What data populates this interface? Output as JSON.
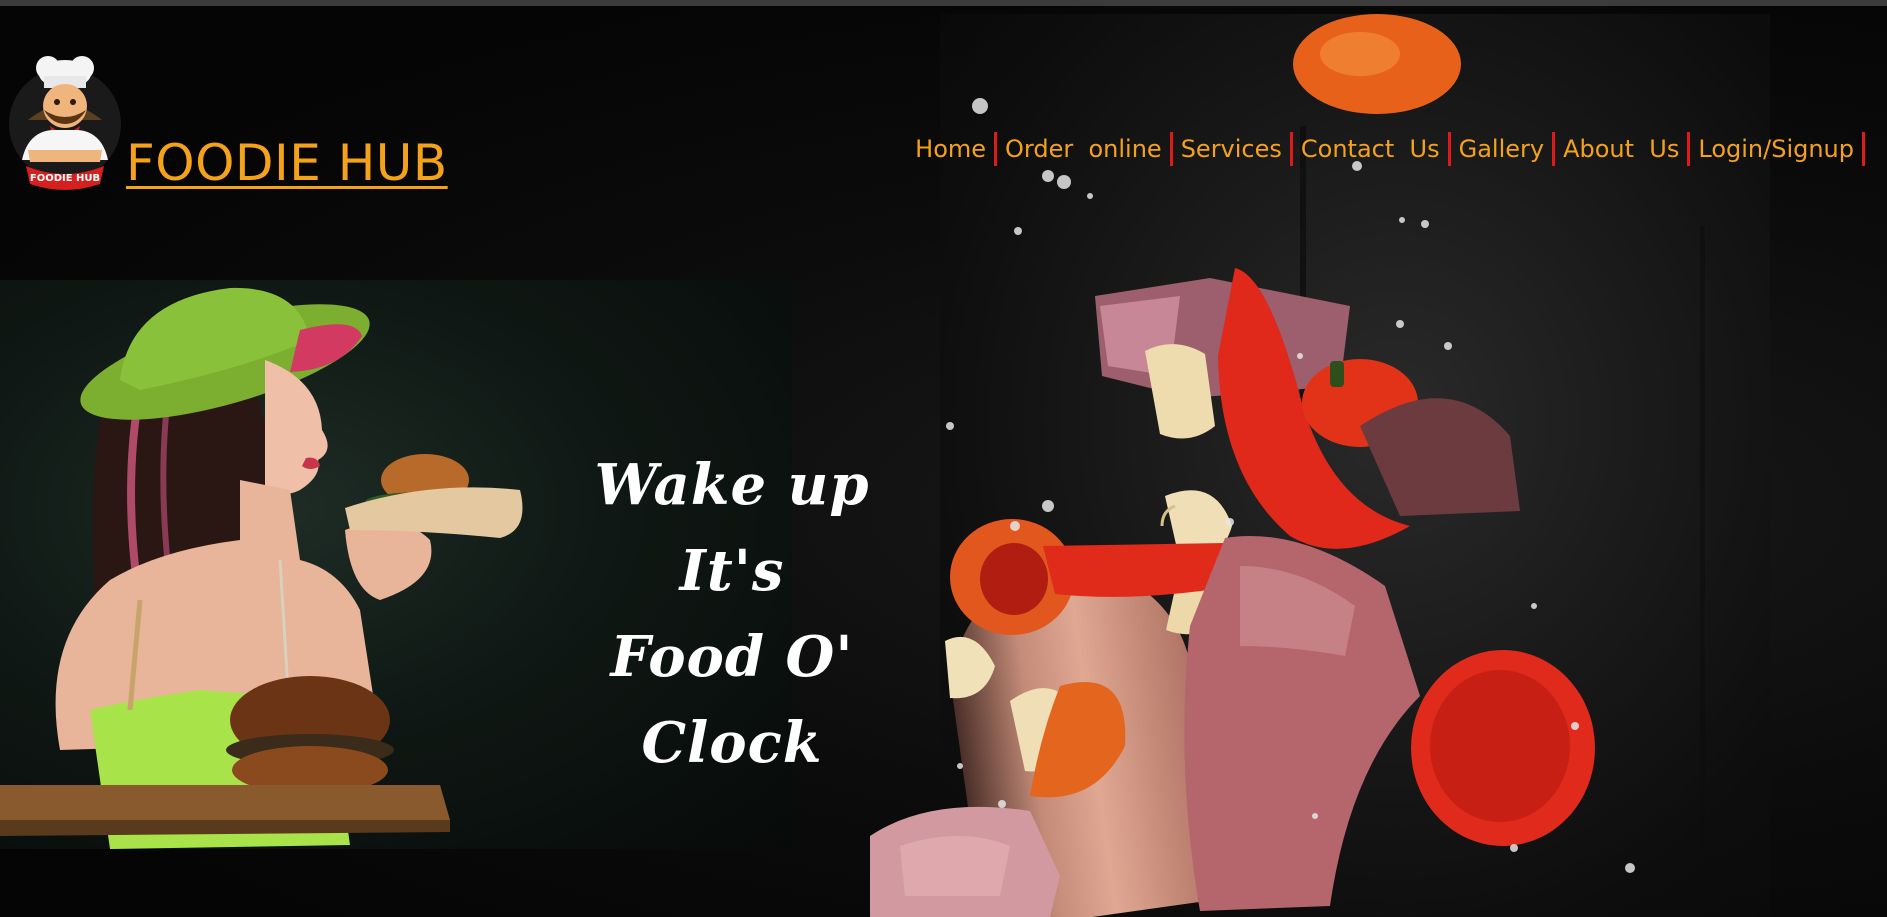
{
  "brand": {
    "name": "FOODIE HUB",
    "logo_icon": "chef-logo-icon",
    "logo_badge_text": "FOODIE HUB"
  },
  "nav": {
    "items": [
      {
        "label": "Home"
      },
      {
        "label": "Order  online"
      },
      {
        "label": "Services"
      },
      {
        "label": "Contact  Us"
      },
      {
        "label": "Gallery"
      },
      {
        "label": "About  Us"
      },
      {
        "label": "Login/Signup"
      }
    ]
  },
  "hero": {
    "tagline_line1": "Wake up",
    "tagline_line2": "It's",
    "tagline_line3": "Food O' Clock"
  },
  "colors": {
    "accent": "#f5a21b",
    "separator": "#e01a1a",
    "background": "#050505",
    "tagline": "#ffffff"
  }
}
